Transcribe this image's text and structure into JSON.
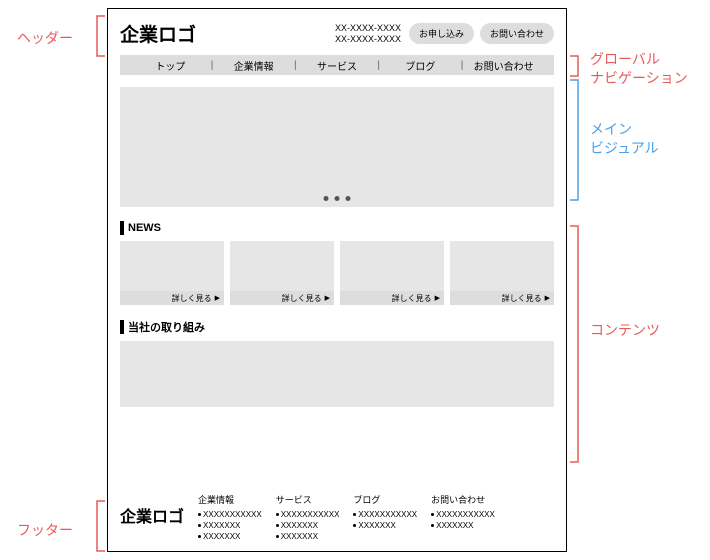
{
  "annotations": {
    "header": "ヘッダー",
    "gnav": "グローバル\nナビゲーション",
    "main_visual": "メイン\nビジュアル",
    "contents": "コンテンツ",
    "footer": "フッター"
  },
  "header": {
    "logo": "企業ロゴ",
    "phone1": "XX-XXXX-XXXX",
    "phone2": "XX-XXXX-XXXX",
    "cta1": "お申し込み",
    "cta2": "お問い合わせ"
  },
  "gnav": {
    "items": [
      "トップ",
      "企業情報",
      "サービス",
      "ブログ",
      "お問い合わせ"
    ]
  },
  "news": {
    "title": "NEWS",
    "more": "詳しく見る"
  },
  "initiatives": {
    "title": "当社の取り組み"
  },
  "footer": {
    "logo": "企業ロゴ",
    "cols": [
      {
        "head": "企業情報",
        "links": [
          "XXXXXXXXXXX",
          "XXXXXXX",
          "XXXXXXX"
        ]
      },
      {
        "head": "サービス",
        "links": [
          "XXXXXXXXXXX",
          "XXXXXXX",
          "XXXXXXX"
        ]
      },
      {
        "head": "ブログ",
        "links": [
          "XXXXXXXXXXX",
          "XXXXXXX"
        ]
      },
      {
        "head": "お問い合わせ",
        "links": [
          "XXXXXXXXXXX",
          "XXXXXXX"
        ]
      }
    ]
  },
  "colors": {
    "pink": "#e85a5a",
    "blue": "#4aa0e8",
    "gray_bg": "#e6e6e6",
    "gray_ui": "#dddddd"
  }
}
